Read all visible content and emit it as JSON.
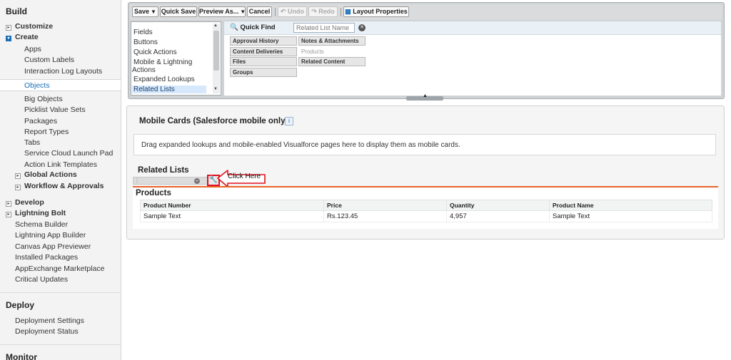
{
  "sidebar": {
    "build": {
      "heading": "Build",
      "customize": "Customize",
      "create": "Create",
      "create_items": [
        "Apps",
        "Custom Labels",
        "Interaction Log Layouts",
        "Objects",
        "Big Objects",
        "Picklist Value Sets",
        "Packages",
        "Report Types",
        "Tabs",
        "Service Cloud Launch Pad",
        "Action Link Templates"
      ],
      "global_actions": "Global Actions",
      "workflow": "Workflow & Approvals",
      "develop": "Develop",
      "lightning_bolt": "Lightning Bolt",
      "more_items": [
        "Schema Builder",
        "Lightning App Builder",
        "Canvas App Previewer",
        "Installed Packages",
        "AppExchange Marketplace",
        "Critical Updates"
      ]
    },
    "deploy": {
      "heading": "Deploy",
      "items": [
        "Deployment Settings",
        "Deployment Status"
      ]
    },
    "monitor": {
      "heading": "Monitor"
    }
  },
  "toolbar": {
    "save": "Save",
    "quick_save": "Quick Save",
    "preview_as": "Preview As...",
    "cancel": "Cancel",
    "undo": "Undo",
    "redo": "Redo",
    "layout_properties": "Layout Properties"
  },
  "palette": {
    "categories": [
      "Fields",
      "Buttons",
      "Quick Actions",
      "Mobile & Lightning",
      "Actions",
      "Expanded Lookups",
      "Related Lists"
    ],
    "selected_category": "Related Lists",
    "quick_find_label": "Quick Find",
    "quick_find_placeholder": "Related List Name",
    "related_lists": [
      {
        "label": "Approval History",
        "enabled": true
      },
      {
        "label": "Notes & Attachments",
        "enabled": true
      },
      {
        "label": "Content Deliveries",
        "enabled": true
      },
      {
        "label": "Products",
        "enabled": false
      },
      {
        "label": "Files",
        "enabled": true
      },
      {
        "label": "Related Content",
        "enabled": true
      },
      {
        "label": "Groups",
        "enabled": true
      }
    ]
  },
  "layout": {
    "mobile_cards_title": "Mobile Cards (Salesforce mobile only)",
    "mobile_cards_info": "i",
    "mobile_cards_hint": "Drag expanded lookups and mobile-enabled Visualforce pages here to display them as mobile cards.",
    "related_lists_title": "Related Lists",
    "annotation": "Click Here",
    "products_title": "Products",
    "table": {
      "headers": [
        "Product Number",
        "Price",
        "Quantity",
        "Product Name"
      ],
      "rows": [
        [
          "Sample Text",
          "Rs.123.45",
          "4,957",
          "Sample Text"
        ]
      ]
    }
  },
  "colors": {
    "accent": "#1b6fb7",
    "section_border": "#e8632b",
    "annotation_red": "#e0101e"
  }
}
